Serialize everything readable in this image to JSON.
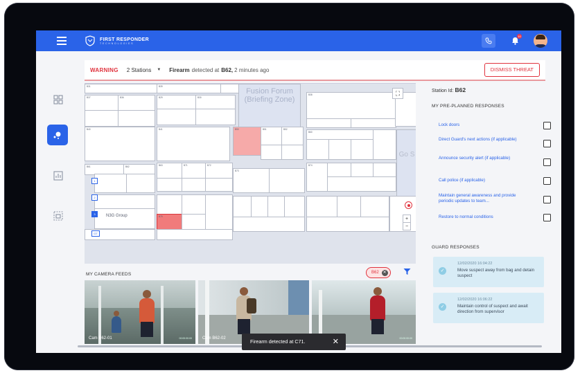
{
  "header": {
    "brand_name": "FIRST RESPONDER",
    "brand_sub": "TECHNOLOGIES",
    "notification_count": "10",
    "icons": [
      "menu-icon",
      "phone-icon",
      "bell-icon"
    ]
  },
  "warning": {
    "label": "WARNING",
    "stations": "2 Stations",
    "weapon": "Firearm",
    "detected_text": "detected at",
    "station": "B62,",
    "time": "2 minutes ago",
    "dismiss": "DISMISS THREAT",
    "accent_color": "#e0323d"
  },
  "map": {
    "zone_label": "Fusion Forum (Briefing Zone)",
    "zone_label_right": "Go S",
    "group_label": "N3G Group",
    "labels": [
      "B31",
      "B39",
      "B38",
      "B37",
      "B36",
      "B29",
      "B30",
      "B40",
      "B41",
      "B50",
      "B51",
      "B52",
      "B60",
      "B61",
      "B62",
      "B63",
      "B71",
      "B72",
      "B73",
      "B74",
      "B75",
      "B76",
      "B80",
      "B81",
      "B82",
      "B83",
      "B84",
      "B85",
      "B86",
      "B87",
      "B88",
      "B89",
      "B90",
      "B91",
      "B92",
      "B93",
      "B94"
    ],
    "markers": [
      "1",
      "2",
      "3",
      "GT"
    ]
  },
  "right_panel": {
    "station_id_label": "Station Id:",
    "station_id": "B62",
    "preplanned_heading": "MY PRE-PLANNED RESPONSES",
    "responses": [
      "Lock doors",
      "Direct Guard's next actions (if applicable)",
      "Announce security alert (if applicable)",
      "Call police (if applicable)",
      "Maintain general awareness and provide periodic updates to team...",
      "Restore to normal conditions"
    ],
    "guard_heading": "GUARD RESPONSES",
    "guard_responses": [
      {
        "time": "12/02/2020 16:04:22",
        "text": "Move suspect away from bag and detain suspect"
      },
      {
        "time": "12/02/2020 16:06:22",
        "text": "Maintain control of suspect and await direction from supervisor"
      }
    ]
  },
  "cameras": {
    "heading": "MY CAMERA FEEDS",
    "chip": "B62",
    "feeds": [
      {
        "label": "Cam B62-01",
        "duration": "00:00:00:00"
      },
      {
        "label": "Cam B62-02",
        "duration": "00:00:00:00"
      },
      {
        "label": "",
        "duration": "00:00:00:00"
      }
    ]
  },
  "toast": {
    "text": "Firearm detected at C71.",
    "close": "✕"
  }
}
